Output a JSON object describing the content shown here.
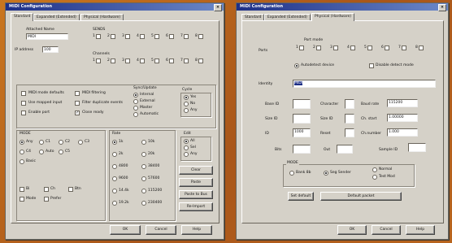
{
  "left_window": {
    "title": "MIDI Configuration",
    "tabs": [
      "Standard",
      "Expanded (Extended)",
      "Physical (Hardware)"
    ],
    "device_name_label": "Attached Name",
    "device_name_value": "MIDI",
    "address_label": "IP address",
    "address_value": "100",
    "channel_group_label": "SENDS",
    "channel_numbers": [
      "1",
      "2",
      "3",
      "4",
      "5",
      "6",
      "7",
      "8"
    ],
    "channel_group_label_2": "Channels",
    "checkboxes_left": [
      "MIDI mode defaults",
      "Use mapped input",
      "Enable port"
    ],
    "checkboxes_mid": [
      "MIDI filtering",
      "Filter duplicate events",
      "Close ready"
    ],
    "options_label": "Sync/Update",
    "options": [
      "Internal",
      "External",
      "Master",
      "Automatic"
    ],
    "cycle_label": "Cycle",
    "cycle_opts": [
      "Yes",
      "No",
      "Any"
    ],
    "mode_label": "MODE",
    "mode_rows": [
      [
        "Any",
        "C1",
        "C2",
        "C3"
      ],
      [
        "C4",
        "Auto",
        "C5"
      ],
      [
        "Basic"
      ]
    ],
    "mode_rows_2": [
      [
        "Bi",
        "Ch",
        "Btn"
      ],
      [
        "Mode",
        "Prefer"
      ]
    ],
    "rate_label": "Rate",
    "rates": [
      [
        "1k",
        "10k"
      ],
      [
        "2k",
        "20k"
      ],
      [
        "4800",
        "38400"
      ],
      [
        "9600",
        "57600"
      ],
      [
        "14.4k",
        "115200"
      ],
      [
        "19.2k",
        "230400"
      ]
    ],
    "edit_label": "Edit",
    "edit_opts": [
      "All",
      "Sel",
      "Any"
    ],
    "side_buttons": [
      "Clear",
      "Paste",
      "Paste to Bus",
      "Re-Import"
    ],
    "footer_buttons": [
      "OK",
      "Cancel",
      "Help"
    ]
  },
  "right_window": {
    "title": "MIDI Configuration",
    "tabs": [
      "Standard",
      "Expanded (Extended)",
      "Physical (Hardware)"
    ],
    "ports_label": "Ports",
    "ports_group": "Port mode",
    "port_numbers": [
      "1",
      "2",
      "3",
      "4",
      "5",
      "6",
      "7",
      "8"
    ],
    "radio_auto": "Autodetect device",
    "radio_manual": "Disable detect mode",
    "identity_label": "Identity",
    "identity_value": "MIDI",
    "fields_row1": [
      "Base ID",
      "Character",
      "Baud rate"
    ],
    "baud_value": "115200",
    "fields_row2": [
      "Size ID",
      "Size ID",
      "Ch. start"
    ],
    "ch_start_value": "1.00000",
    "fields_row3": [
      "ID",
      "Reset",
      "Ch.number"
    ],
    "id_value": "1000",
    "ch_number_value": "1.000",
    "fields_row4": [
      "Bits",
      "Out",
      "Sample ID"
    ],
    "mode_label": "MODE",
    "mode_opts": [
      "Bank 8b",
      "Seg Sender",
      "Normal",
      "Test Mod"
    ],
    "bottom_buttons": [
      "Set default",
      "Default packet"
    ],
    "footer_buttons": [
      "OK",
      "Cancel",
      "Help"
    ]
  }
}
